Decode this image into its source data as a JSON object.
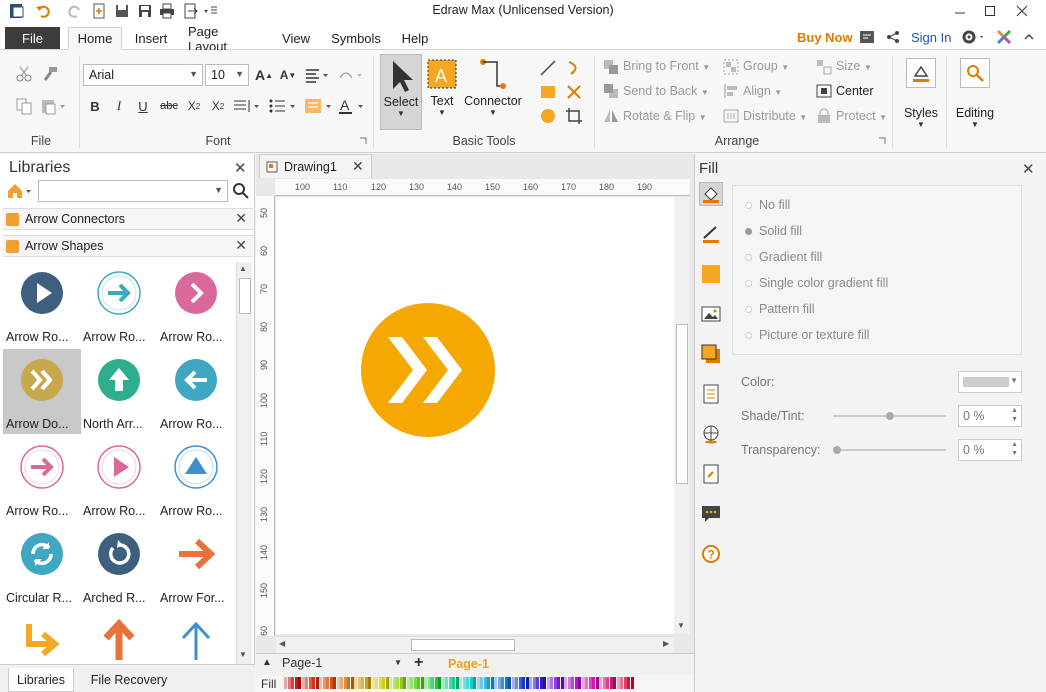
{
  "window": {
    "title": "Edraw Max (Unlicensed Version)"
  },
  "menu": {
    "file": "File",
    "tabs": [
      "Home",
      "Insert",
      "Page Layout",
      "View",
      "Symbols",
      "Help"
    ],
    "active_tab": "Home",
    "buy_now": "Buy Now",
    "sign_in": "Sign In"
  },
  "ribbon": {
    "groups": {
      "file": "File",
      "font": "Font",
      "basic_tools": "Basic Tools",
      "arrange": "Arrange"
    },
    "font_name": "Arial",
    "font_size": "10",
    "tools": {
      "select": "Select",
      "text": "Text",
      "connector": "Connector"
    },
    "arrange": {
      "bring_front": "Bring to Front",
      "send_back": "Send to Back",
      "rotate_flip": "Rotate & Flip",
      "group": "Group",
      "align": "Align",
      "distribute": "Distribute",
      "size": "Size",
      "center": "Center",
      "protect": "Protect"
    },
    "styles": "Styles",
    "editing": "Editing"
  },
  "libraries": {
    "title": "Libraries",
    "search_placeholder": "",
    "categories": [
      "Arrow Connectors",
      "Arrow Shapes"
    ],
    "shapes": [
      {
        "label": "Arrow Ro...",
        "color": "#3f5f7f",
        "icon": "play-icon"
      },
      {
        "label": "Arrow Ro...",
        "color": "#3fa7c0",
        "icon": "arrow-right-icon"
      },
      {
        "label": "Arrow Ro...",
        "color": "#d9699a",
        "icon": "chevron-right-icon"
      },
      {
        "label": "Arrow Do...",
        "color": "#c8a84d",
        "icon": "double-chevron-icon"
      },
      {
        "label": "North Arr...",
        "color": "#2fae8f",
        "icon": "arrow-up-icon"
      },
      {
        "label": "Arrow Ro...",
        "color": "#3fa7c0",
        "icon": "arrow-left-icon"
      },
      {
        "label": "Arrow Ro...",
        "color": "#d9699a",
        "icon": "arrow-right-icon"
      },
      {
        "label": "Arrow Ro...",
        "color": "#d9699a",
        "icon": "play-icon"
      },
      {
        "label": "Arrow Ro...",
        "color": "#3f8fd0",
        "icon": "triangle-up-icon"
      },
      {
        "label": "Circular R...",
        "color": "#3fa7c0",
        "icon": "refresh-icon"
      },
      {
        "label": "Arched R...",
        "color": "#3f5f7f",
        "icon": "rotate-icon"
      },
      {
        "label": "Arrow For...",
        "color": "#e8733a",
        "icon": "arrow-forward-icon"
      },
      {
        "label": "",
        "color": "#f5a623",
        "icon": "bent-arrow-icon"
      },
      {
        "label": "",
        "color": "#e8733a",
        "icon": "arrow-up-icon"
      },
      {
        "label": "",
        "color": "#3f8fd0",
        "icon": "arrow-up-icon"
      }
    ],
    "bottom_tabs": [
      "Libraries",
      "File Recovery"
    ]
  },
  "document": {
    "tab": "Drawing1",
    "hruler": [
      "100",
      "110",
      "120",
      "130",
      "140",
      "150",
      "160",
      "170",
      "180",
      "190"
    ],
    "vruler": [
      "50",
      "60",
      "70",
      "80",
      "90",
      "100",
      "110",
      "120",
      "130",
      "140",
      "150",
      "60"
    ],
    "shape_color": "#f5a800",
    "page_select": "Page-1",
    "page_tab": "Page-1",
    "fill_label": "Fill"
  },
  "fill": {
    "title": "Fill",
    "options": [
      "No fill",
      "Solid fill",
      "Gradient fill",
      "Single color gradient fill",
      "Pattern fill",
      "Picture or texture fill"
    ],
    "selected": "Solid fill",
    "color_label": "Color:",
    "shade_label": "Shade/Tint:",
    "shade_value": "0 %",
    "transparency_label": "Transparency:",
    "transparency_value": "0 %"
  },
  "colors": {
    "accent": "#e07b00",
    "file_tab": "#3c3c3c"
  }
}
